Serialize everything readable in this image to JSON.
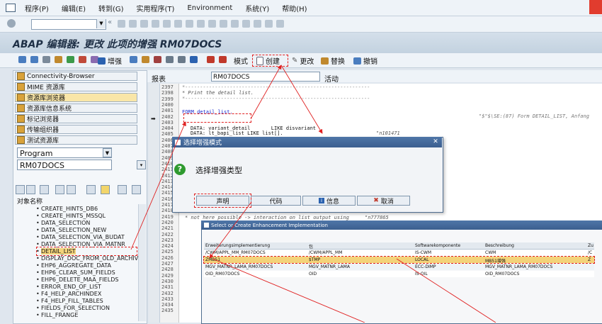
{
  "menu": [
    "程序(P)",
    "编辑(E)",
    "转到(G)",
    "实用程序(T)",
    "Environment",
    "系统(Y)",
    "帮助(H)"
  ],
  "title": "ABAP 编辑器: 更改 此项的增强 RM07DOCS",
  "app_toolbar": {
    "enhance_label": "增强",
    "mode_label": "模式",
    "create_label": "创建",
    "change_label": "更改",
    "replace_label": "替换",
    "undo_label": "撤销"
  },
  "left_panel": {
    "nav_buttons": [
      "Connectivity-Browser",
      "MIME 资源库",
      "资源库浏览器",
      "资源库信息系统",
      "标记浏览器",
      "传输组织器",
      "测试资源库"
    ],
    "object_type": "Program",
    "object_name": "RM07DOCS",
    "tree_header": "对象名称",
    "tree_items": [
      "CREATE_HINTS_DB6",
      "CREATE_HINTS_MSSQL",
      "DATA_SELECTION",
      "DATA_SELECTION_NEW",
      "DATA_SELECTION_VIA_BUDAT",
      "DATA_SELECTION_VIA_MATNR",
      "DETAIL_LIST",
      "DISPLAY_DOC_FROM_OLD_ARCHIVE",
      "EHP6_AGGREGATE_DATA",
      "EHP6_CLEAR_SUM_FIELDS",
      "EHP6_DELETE_MAA_FIELDS",
      "ERROR_END_OF_LIST",
      "F4_HELP_ARCHINDEX",
      "F4_HELP_FILL_TABLES",
      "FIELDS_FOR_SELECTION",
      "FILL_FRANGE"
    ]
  },
  "editor": {
    "label": "报表",
    "program": "RM07DOCS",
    "status": "活动",
    "line_numbers": [
      "2397",
      "2398",
      "2399",
      "2400",
      "2401",
      "2402",
      "2403",
      "2404",
      "2405",
      "2406",
      "2407",
      "2408",
      "2409",
      "2410",
      "2411",
      "2412",
      "2413",
      "2414",
      "2415",
      "2416",
      "2417",
      "2418",
      "2419",
      "2420",
      "2421",
      "2422",
      "2423",
      "2424",
      "2425",
      "2426",
      "2427",
      "2428",
      "2429",
      "2430",
      "2431",
      "2432",
      "2433",
      "2434",
      "2435"
    ],
    "code_visible": {
      "line_2398": "* Print the detail list.",
      "line_2401": "FORM detail_list.",
      "line_2401_comment": "\"$\"$\\SE:(87) Form DETAIL_LIST, Anfang",
      "line_2404": "DATA: variant_detail       LIKE disvariant",
      "line_2405": "DATA: lt_bapi_list LIKE list[].",
      "line_2405_tail": "\"n101471",
      "line_2417": "* not here possible -> interaction on list output using",
      "line_2417_tail": "\"n777865"
    }
  },
  "dialog": {
    "title": "选择增强模式",
    "message": "选择增强类型",
    "buttons": [
      "声明",
      "代码",
      "信息",
      "取消"
    ]
  },
  "enhancement_window": {
    "title": "Select or Create Enhancement Implementation",
    "headers": [
      "Erweiterungsimplementierung",
      "包",
      "Softwarekomponente",
      "Beschreibung",
      "Zu"
    ],
    "rows": [
      [
        "/CWM/APPL_MM_RM07DOCS",
        "/CWM/APPL_MM",
        "IS-CWM",
        "CWM",
        "/C"
      ],
      [
        "ZMB51",
        "$TMP",
        "LOCAL",
        "MB51增强",
        "Z"
      ],
      [
        "MGV_MATNR_LAMA_RM07DOCS",
        "MGV_MATNR_LAMA",
        "ECC-DIMP",
        "MGV_MATNR_LAMA_RM07DOCS",
        ""
      ],
      [
        "OID_RM07DOCS",
        "OID",
        "IS-OIL",
        "OID_RM07DOCS",
        ""
      ]
    ]
  },
  "colors": {
    "annotation": "#e02020",
    "title_bg": "#c3d2e0",
    "dialog_title": "#3c5f8f",
    "highlight_row": "#f3d37a"
  }
}
